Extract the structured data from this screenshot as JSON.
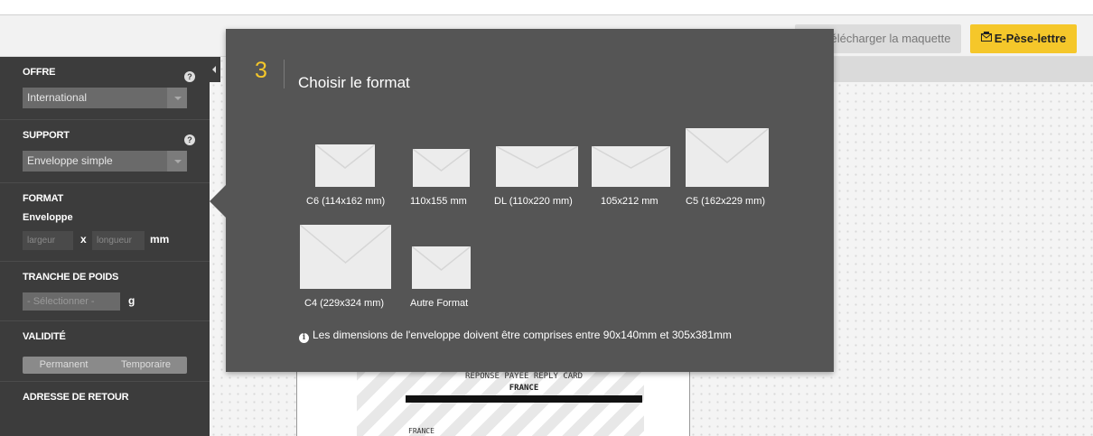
{
  "toolbar": {
    "download_label": "Télécharger la maquette",
    "pese_lettre_label": "E-Pèse-lettre"
  },
  "sidebar": {
    "offre": {
      "title": "OFFRE",
      "value": "International"
    },
    "support": {
      "title": "SUPPORT",
      "value": "Enveloppe simple"
    },
    "format": {
      "title": "FORMAT",
      "sub_label": "Enveloppe",
      "width_placeholder": "largeur",
      "separator": "x",
      "length_placeholder": "longueur",
      "unit": "mm"
    },
    "poids": {
      "title": "TRANCHE DE POIDS",
      "select_value": "- Sélectionner -",
      "unit": "g"
    },
    "validite": {
      "title": "VALIDITÉ",
      "option_1": "Permanent",
      "option_2": "Temporaire"
    },
    "adresse": {
      "title": "ADRESSE DE RETOUR"
    },
    "help_glyph": "?"
  },
  "panel": {
    "step_number": "3",
    "step_title": "Choisir le format",
    "formats": [
      {
        "label": "C6 (114x162 mm)"
      },
      {
        "label": "110x155 mm"
      },
      {
        "label": "DL (110x220 mm)"
      },
      {
        "label": "105x212 mm"
      },
      {
        "label": "C5 (162x229 mm)"
      },
      {
        "label": "C4 (229x324 mm)"
      },
      {
        "label": "Autre Format"
      }
    ],
    "info_icon": "i",
    "info_text": "Les dimensions de l'enveloppe doivent être comprises entre 90x140mm et 305x381mm"
  },
  "canvas_doc": {
    "line1": "REPONSE PAYEE REPLY CARD",
    "line2": "FRANCE",
    "line3": "FRANCE"
  },
  "colors": {
    "accent": "#f5c72a",
    "sidebar_bg": "#3c3c3c",
    "panel_bg": "#555555",
    "envelope": "#ececec"
  }
}
